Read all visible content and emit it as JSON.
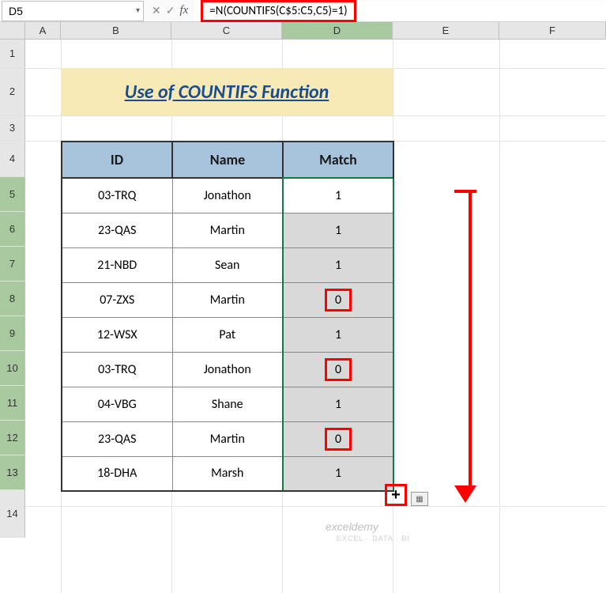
{
  "name_box": "D5",
  "formula": "=N(COUNTIFS(C$5:C5,C5)=1)",
  "title": "Use of COUNTIFS Function",
  "columns": [
    "A",
    "B",
    "C",
    "D",
    "E",
    "F"
  ],
  "row_numbers": [
    "1",
    "2",
    "3",
    "4",
    "5",
    "6",
    "7",
    "8",
    "9",
    "10",
    "11",
    "12",
    "13",
    "14"
  ],
  "headers": {
    "id": "ID",
    "name": "Name",
    "match": "Match"
  },
  "rows": [
    {
      "id": "03-TRQ",
      "name": "Jonathon",
      "match": "1",
      "highlight": false
    },
    {
      "id": "23-QAS",
      "name": "Martin",
      "match": "1",
      "highlight": false
    },
    {
      "id": "21-NBD",
      "name": "Sean",
      "match": "1",
      "highlight": false
    },
    {
      "id": "07-ZXS",
      "name": "Martin",
      "match": "0",
      "highlight": true
    },
    {
      "id": "12-WSX",
      "name": "Pat",
      "match": "1",
      "highlight": false
    },
    {
      "id": "03-TRQ",
      "name": "Jonathon",
      "match": "0",
      "highlight": true
    },
    {
      "id": "04-VBG",
      "name": "Shane",
      "match": "1",
      "highlight": false
    },
    {
      "id": "23-QAS",
      "name": "Martin",
      "match": "0",
      "highlight": true
    },
    {
      "id": "18-DHA",
      "name": "Marsh",
      "match": "1",
      "highlight": false
    }
  ],
  "watermark": "exceldemy",
  "watermark_sub": "EXCEL · DATA · BI",
  "fx_label": "fx"
}
